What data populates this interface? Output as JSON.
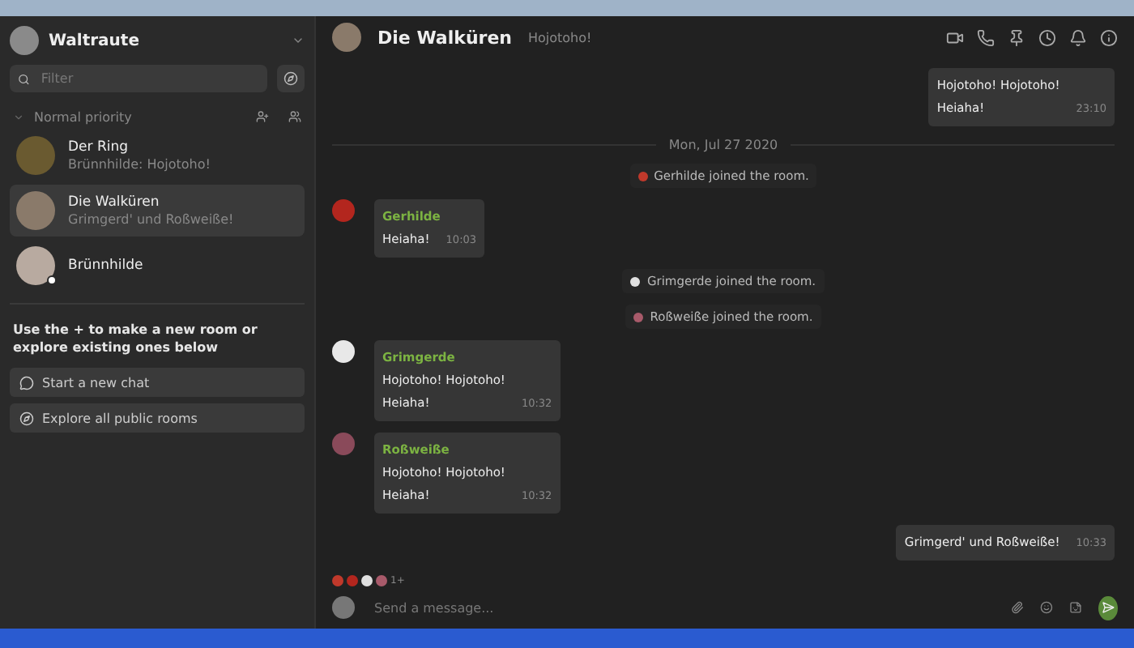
{
  "user": {
    "name": "Waltraute"
  },
  "filter": {
    "placeholder": "Filter"
  },
  "section": {
    "title": "Normal priority",
    "expanded": true
  },
  "rooms": [
    {
      "name": "Der Ring",
      "preview": "Brünnhilde: Hojotoho!",
      "selected": false,
      "online": false
    },
    {
      "name": "Die Walküren",
      "preview": "Grimgerd' und Roßweiße!",
      "selected": true,
      "online": false
    },
    {
      "name": "Brünnhilde",
      "selected": false,
      "online": true
    }
  ],
  "hint": "Use the + to make a new room or explore existing ones below",
  "actions": [
    {
      "kind": "chat",
      "label": "Start a new chat"
    },
    {
      "kind": "explore",
      "label": "Explore all public rooms"
    }
  ],
  "room": {
    "name": "Die Walküren",
    "topic": "Hojotoho!"
  },
  "timeline": [
    {
      "kind": "cut"
    },
    {
      "kind": "own",
      "lines": [
        "Hojotoho! Hojotoho!",
        "Heiaha!"
      ],
      "time": "23:10"
    },
    {
      "kind": "date",
      "text": "Mon, Jul 27 2020"
    },
    {
      "kind": "event",
      "text": "Gerhilde joined the room.",
      "color": "#c0392b"
    },
    {
      "kind": "message",
      "sender": "Gerhilde",
      "lines": [
        "Heiaha!"
      ],
      "time": "10:03",
      "color": "#b3261e"
    },
    {
      "kind": "event",
      "text": "Grimgerde joined the room.",
      "color": "#e0e0e0"
    },
    {
      "kind": "event",
      "text": "Roßweiße joined the room.",
      "color": "#a85a6a"
    },
    {
      "kind": "message",
      "sender": "Grimgerde",
      "lines": [
        "Hojotoho! Hojotoho!",
        "Heiaha!"
      ],
      "time": "10:32",
      "color": "#e8e8e8"
    },
    {
      "kind": "message",
      "sender": "Roßweiße",
      "lines": [
        "Hojotoho! Hojotoho!",
        "Heiaha!"
      ],
      "time": "10:32",
      "color": "#8a4a5a"
    },
    {
      "kind": "own",
      "lines": [
        "Grimgerd' und Roßweiße!"
      ],
      "time": "10:33"
    }
  ],
  "receipts": {
    "count": "1+"
  },
  "composer": {
    "placeholder": "Send a message..."
  }
}
